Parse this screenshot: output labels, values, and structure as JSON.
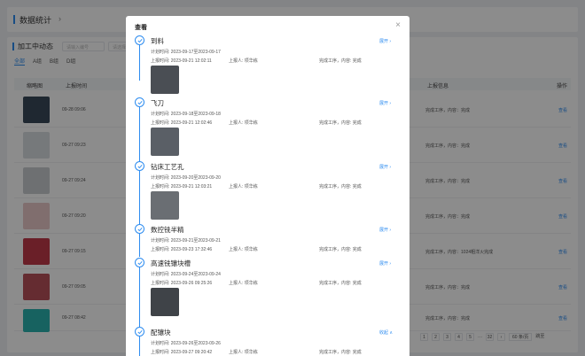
{
  "page": {
    "header_title": "数据统计",
    "panel_title": "加工中动态",
    "filter_placeholders": [
      "请输入编号",
      "请选择日期"
    ],
    "tabs": [
      {
        "label": "全部",
        "active": true
      },
      {
        "label": "A组",
        "active": false
      },
      {
        "label": "B组",
        "active": false
      },
      {
        "label": "D组",
        "active": false
      }
    ],
    "columns": {
      "thumb": "缩略图",
      "upload": "上报时间",
      "info": "上报信息",
      "op": "操作"
    },
    "rows": [
      {
        "time": "09-28 09:06",
        "info": "完成工序，内容：完成",
        "op": "查看"
      },
      {
        "time": "09-27 09:23",
        "info": "完成工序，内容：完成",
        "op": "查看"
      },
      {
        "time": "09-27 09:24",
        "info": "完成工序，内容：完成",
        "op": "查看"
      },
      {
        "time": "09-27 09:20",
        "info": "完成工序，内容：完成",
        "op": "查看"
      },
      {
        "time": "09-27 09:15",
        "info": "完成工序，内容：1024粗洋火完成",
        "op": "查看"
      },
      {
        "time": "09-27 09:05",
        "info": "完成工序，内容：完成",
        "op": "查看"
      },
      {
        "time": "09-27 08:42",
        "info": "完成工序，内容：完成",
        "op": "查看"
      }
    ],
    "pager": {
      "pages": [
        "1",
        "2",
        "3",
        "4",
        "5",
        "···",
        "32",
        "›"
      ],
      "size": "60 条/页",
      "jump": "跳至"
    }
  },
  "modal": {
    "title": "查看",
    "close": "×",
    "steps": [
      {
        "name": "到料",
        "plan": "计划时间:  2023-09-17至2023-09-17",
        "upload_time": "上报时间:  2023-09-21 12:02:11",
        "reporter": "上报人:  项华栋",
        "content": "完成工序，内容:  完成",
        "action": "展开 ›"
      },
      {
        "name": "飞刀",
        "plan": "计划时间:  2023-09-18至2023-09-18",
        "upload_time": "上报时间:  2023-09-21 12:02:46",
        "reporter": "上报人:  项华栋",
        "content": "完成工序，内容:  完成",
        "action": "展开 ›"
      },
      {
        "name": "钻床工艺孔",
        "plan": "计划时间:  2023-09-20至2023-09-20",
        "upload_time": "上报时间:  2023-09-21 12:03:21",
        "reporter": "上报人:  项华栋",
        "content": "完成工序，内容:  完成",
        "action": "展开 ›"
      },
      {
        "name": "数控铣半精",
        "plan": "计划时间:  2023-09-21至2023-09-21",
        "upload_time": "上报时间:  2023-09-23 17:32:46",
        "reporter": "上报人:  项华栋",
        "content": "完成工序，内容:  完成",
        "action": "展开 ›"
      },
      {
        "name": "高速铣镶块槽",
        "plan": "计划时间:  2023-09-24至2023-09-24",
        "upload_time": "上报时间:  2023-09-26 09:25:26",
        "reporter": "上报人:  项华栋",
        "content": "完成工序，内容:  完成",
        "action": "展开 ›"
      },
      {
        "name": "配镶块",
        "plan": "计划时间:  2023-09-26至2023-09-26",
        "upload_time": "上报时间:  2023-09-27 09:20:42",
        "reporter": "上报人:  项华栋",
        "content": "完成工序，内容:  完成",
        "action": "收起 ∧"
      }
    ]
  },
  "colors": {
    "accent": "#2d8cf0",
    "mask": "rgba(0,0,0,0.45)"
  },
  "icons": {
    "step_done": "check-circle-icon",
    "close": "close-icon"
  }
}
